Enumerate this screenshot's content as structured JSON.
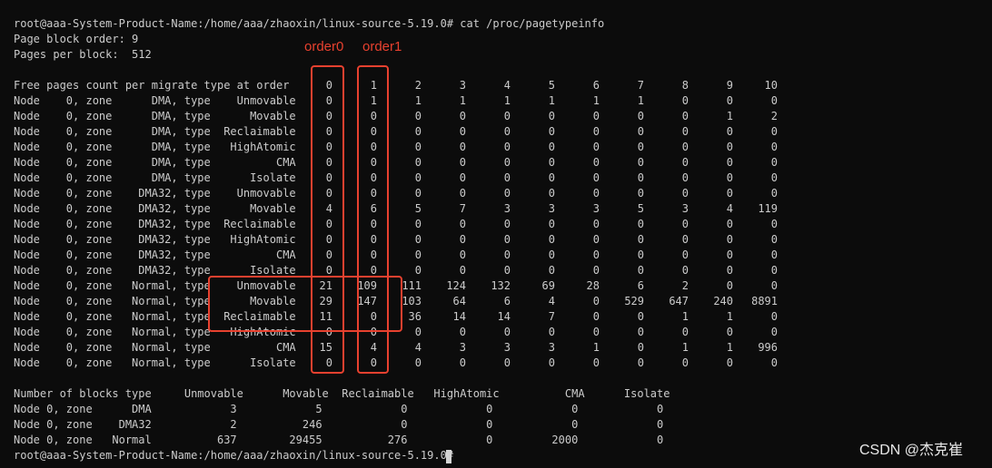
{
  "prompt_cmd": "root@aaa-System-Product-Name:/home/aaa/zhaoxin/linux-source-5.19.0# cat /proc/pagetypeinfo",
  "page_block_order": "Page block order: 9",
  "pages_per_block": "Pages per block:  512",
  "free_header": "Free pages count per migrate type at order",
  "orders": [
    "0",
    "1",
    "2",
    "3",
    "4",
    "5",
    "6",
    "7",
    "8",
    "9",
    "10"
  ],
  "rows": [
    {
      "label": "Node    0, zone      DMA, type    Unmovable",
      "vals": [
        "0",
        "1",
        "1",
        "1",
        "1",
        "1",
        "1",
        "1",
        "0",
        "0",
        "0"
      ]
    },
    {
      "label": "Node    0, zone      DMA, type      Movable",
      "vals": [
        "0",
        "0",
        "0",
        "0",
        "0",
        "0",
        "0",
        "0",
        "0",
        "1",
        "2"
      ]
    },
    {
      "label": "Node    0, zone      DMA, type  Reclaimable",
      "vals": [
        "0",
        "0",
        "0",
        "0",
        "0",
        "0",
        "0",
        "0",
        "0",
        "0",
        "0"
      ]
    },
    {
      "label": "Node    0, zone      DMA, type   HighAtomic",
      "vals": [
        "0",
        "0",
        "0",
        "0",
        "0",
        "0",
        "0",
        "0",
        "0",
        "0",
        "0"
      ]
    },
    {
      "label": "Node    0, zone      DMA, type          CMA",
      "vals": [
        "0",
        "0",
        "0",
        "0",
        "0",
        "0",
        "0",
        "0",
        "0",
        "0",
        "0"
      ]
    },
    {
      "label": "Node    0, zone      DMA, type      Isolate",
      "vals": [
        "0",
        "0",
        "0",
        "0",
        "0",
        "0",
        "0",
        "0",
        "0",
        "0",
        "0"
      ]
    },
    {
      "label": "Node    0, zone    DMA32, type    Unmovable",
      "vals": [
        "0",
        "0",
        "0",
        "0",
        "0",
        "0",
        "0",
        "0",
        "0",
        "0",
        "0"
      ]
    },
    {
      "label": "Node    0, zone    DMA32, type      Movable",
      "vals": [
        "4",
        "6",
        "5",
        "7",
        "3",
        "3",
        "3",
        "5",
        "3",
        "4",
        "119"
      ]
    },
    {
      "label": "Node    0, zone    DMA32, type  Reclaimable",
      "vals": [
        "0",
        "0",
        "0",
        "0",
        "0",
        "0",
        "0",
        "0",
        "0",
        "0",
        "0"
      ]
    },
    {
      "label": "Node    0, zone    DMA32, type   HighAtomic",
      "vals": [
        "0",
        "0",
        "0",
        "0",
        "0",
        "0",
        "0",
        "0",
        "0",
        "0",
        "0"
      ]
    },
    {
      "label": "Node    0, zone    DMA32, type          CMA",
      "vals": [
        "0",
        "0",
        "0",
        "0",
        "0",
        "0",
        "0",
        "0",
        "0",
        "0",
        "0"
      ]
    },
    {
      "label": "Node    0, zone    DMA32, type      Isolate",
      "vals": [
        "0",
        "0",
        "0",
        "0",
        "0",
        "0",
        "0",
        "0",
        "0",
        "0",
        "0"
      ]
    },
    {
      "label": "Node    0, zone   Normal, type    Unmovable",
      "vals": [
        "21",
        "109",
        "111",
        "124",
        "132",
        "69",
        "28",
        "6",
        "2",
        "0",
        "0"
      ]
    },
    {
      "label": "Node    0, zone   Normal, type      Movable",
      "vals": [
        "29",
        "147",
        "103",
        "64",
        "6",
        "4",
        "0",
        "529",
        "647",
        "240",
        "8891"
      ]
    },
    {
      "label": "Node    0, zone   Normal, type  Reclaimable",
      "vals": [
        "11",
        "0",
        "36",
        "14",
        "14",
        "7",
        "0",
        "0",
        "1",
        "1",
        "0"
      ]
    },
    {
      "label": "Node    0, zone   Normal, type   HighAtomic",
      "vals": [
        "0",
        "0",
        "0",
        "0",
        "0",
        "0",
        "0",
        "0",
        "0",
        "0",
        "0"
      ]
    },
    {
      "label": "Node    0, zone   Normal, type          CMA",
      "vals": [
        "15",
        "4",
        "4",
        "3",
        "3",
        "3",
        "1",
        "0",
        "1",
        "1",
        "996"
      ]
    },
    {
      "label": "Node    0, zone   Normal, type      Isolate",
      "vals": [
        "0",
        "0",
        "0",
        "0",
        "0",
        "0",
        "0",
        "0",
        "0",
        "0",
        "0"
      ]
    }
  ],
  "blocks_header": "Number of blocks type     Unmovable      Movable  Reclaimable   HighAtomic          CMA      Isolate",
  "blocks_rows": [
    "Node 0, zone      DMA            3            5            0            0            0            0",
    "Node 0, zone    DMA32            2          246            0            0            0            0",
    "Node 0, zone   Normal          637        29455          276            0         2000            0"
  ],
  "prompt_end": "root@aaa-System-Product-Name:/home/aaa/zhaoxin/linux-source-5.19.0#",
  "annotations": {
    "order0": "order0",
    "order1": "order1"
  },
  "watermark": "CSDN @杰克崔",
  "colors": {
    "background": "#0c0c0c",
    "text": "#cccccc",
    "annotation": "#e8412f"
  }
}
